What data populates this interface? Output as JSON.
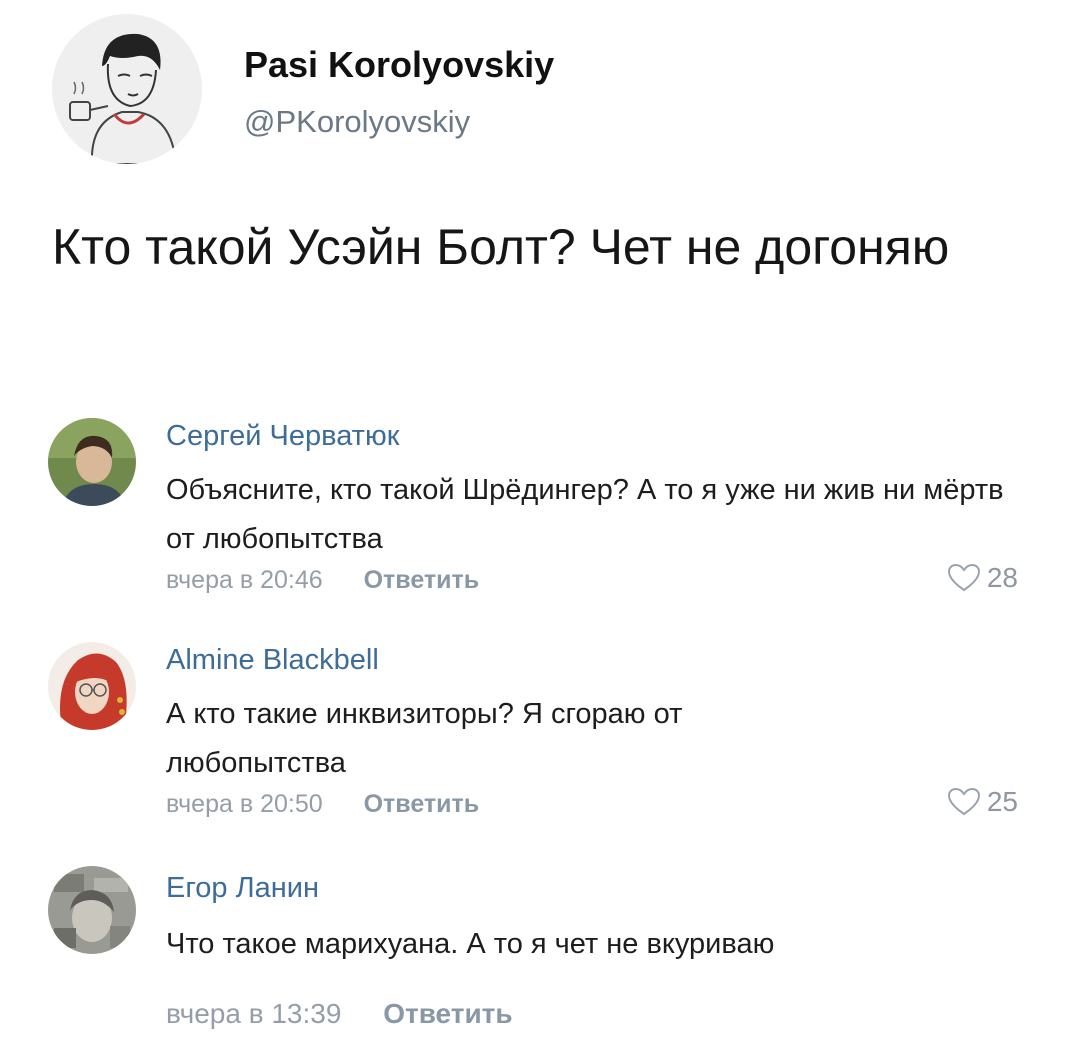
{
  "tweet": {
    "author_name": "Pasi Korolyovskiy",
    "author_handle": "@PKorolyovskiy",
    "text": "Кто такой Усэйн Болт? Чет не догоняю"
  },
  "comments": [
    {
      "name": "Сергей Черватюк",
      "text": "Объясните, кто такой Шрёдингер? А то я уже ни жив ни мёртв от любопытства",
      "time": "вчера в 20:46",
      "reply_label": "Ответить",
      "likes": "28"
    },
    {
      "name": "Almine Blackbell",
      "text": "А кто такие инквизиторы? Я сгораю от любопытства",
      "time": "вчера в 20:50",
      "reply_label": "Ответить",
      "likes": "25"
    },
    {
      "name": "Егор Ланин",
      "text": "Что такое марихуана. А то я чет не вкуриваю",
      "time": "вчера в 13:39",
      "reply_label": "Ответить"
    }
  ],
  "colors": {
    "comment_name": "#3e6c99",
    "meta_text": "#959ea8",
    "handle_text": "#6b7885"
  },
  "icons": [
    "heart-outline-icon"
  ]
}
